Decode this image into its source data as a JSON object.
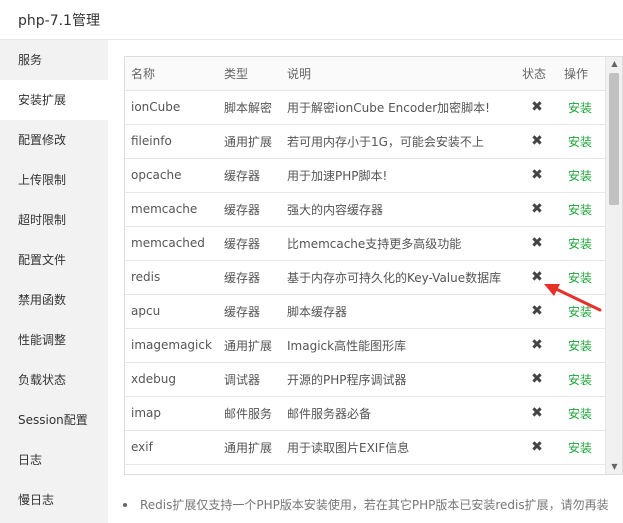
{
  "window": {
    "title": "php-7.1管理"
  },
  "sidebar": {
    "items": [
      {
        "label": "服务"
      },
      {
        "label": "安装扩展"
      },
      {
        "label": "配置修改"
      },
      {
        "label": "上传限制"
      },
      {
        "label": "超时限制"
      },
      {
        "label": "配置文件"
      },
      {
        "label": "禁用函数"
      },
      {
        "label": "性能调整"
      },
      {
        "label": "负载状态"
      },
      {
        "label": "Session配置"
      },
      {
        "label": "日志"
      },
      {
        "label": "慢日志"
      }
    ],
    "active_index": 1
  },
  "table": {
    "headers": {
      "name": "名称",
      "type": "类型",
      "desc": "说明",
      "status": "状态",
      "action": "操作"
    },
    "rows": [
      {
        "name": "ionCube",
        "type": "脚本解密",
        "desc": "用于解密ionCube Encoder加密脚本!",
        "status": "✖",
        "action": "安装"
      },
      {
        "name": "fileinfo",
        "type": "通用扩展",
        "desc": "若可用内存小于1G，可能会安装不上",
        "status": "✖",
        "action": "安装"
      },
      {
        "name": "opcache",
        "type": "缓存器",
        "desc": "用于加速PHP脚本!",
        "status": "✖",
        "action": "安装"
      },
      {
        "name": "memcache",
        "type": "缓存器",
        "desc": "强大的内容缓存器",
        "status": "✖",
        "action": "安装"
      },
      {
        "name": "memcached",
        "type": "缓存器",
        "desc": "比memcache支持更多高级功能",
        "status": "✖",
        "action": "安装"
      },
      {
        "name": "redis",
        "type": "缓存器",
        "desc": "基于内存亦可持久化的Key-Value数据库",
        "status": "✖",
        "action": "安装"
      },
      {
        "name": "apcu",
        "type": "缓存器",
        "desc": "脚本缓存器",
        "status": "✖",
        "action": "安装"
      },
      {
        "name": "imagemagick",
        "type": "通用扩展",
        "desc": "Imagick高性能图形库",
        "status": "✖",
        "action": "安装"
      },
      {
        "name": "xdebug",
        "type": "调试器",
        "desc": "开源的PHP程序调试器",
        "status": "✖",
        "action": "安装"
      },
      {
        "name": "imap",
        "type": "邮件服务",
        "desc": "邮件服务器必备",
        "status": "✖",
        "action": "安装"
      },
      {
        "name": "exif",
        "type": "通用扩展",
        "desc": "用于读取图片EXIF信息",
        "status": "✖",
        "action": "安装"
      }
    ]
  },
  "notes": [
    "Redis扩展仅支持一个PHP版本安装使用，若在其它PHP版本已安装redis扩展，请勿再装"
  ],
  "colors": {
    "install_link": "#20a53a",
    "annotation_arrow": "#e8302a",
    "sidebar_bg": "#f2f2f2"
  },
  "icons": {
    "status": "close-icon",
    "annotation": "red-arrow-annotation"
  }
}
